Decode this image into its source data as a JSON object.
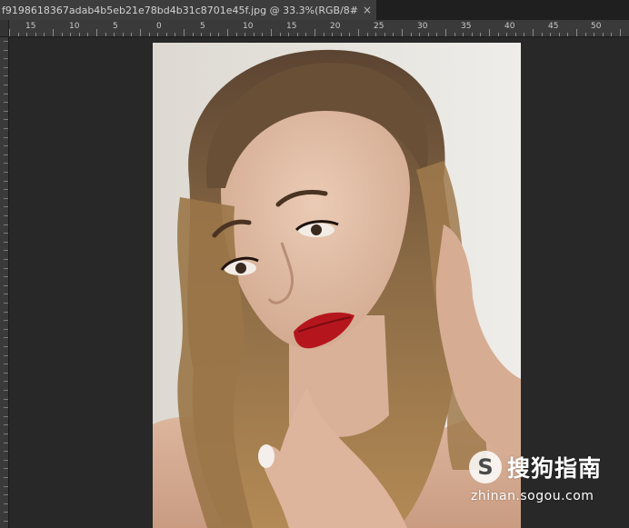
{
  "document_tab": {
    "title": "f9198618367adab4b5eb21e78bd4b31c8701e45f.jpg @ 33.3%(RGB/8#)",
    "close_glyph": "×"
  },
  "ruler": {
    "labels": [
      "15",
      "10",
      "5",
      "0",
      "5",
      "10",
      "15",
      "20",
      "25",
      "30",
      "35",
      "40",
      "45",
      "50"
    ]
  },
  "image_content": {
    "description_icon": "portrait-photo",
    "subject": "woman with wavy brown hair and red lipstick"
  },
  "watermark": {
    "logo_glyph": "S",
    "brand": "搜狗指南",
    "url": "zhinan.sogou.com"
  },
  "colors": {
    "app_background": "#282828",
    "tab_background": "#3d3d3d",
    "ruler_background": "#3a3a3a",
    "lip_red": "#b5161d"
  }
}
